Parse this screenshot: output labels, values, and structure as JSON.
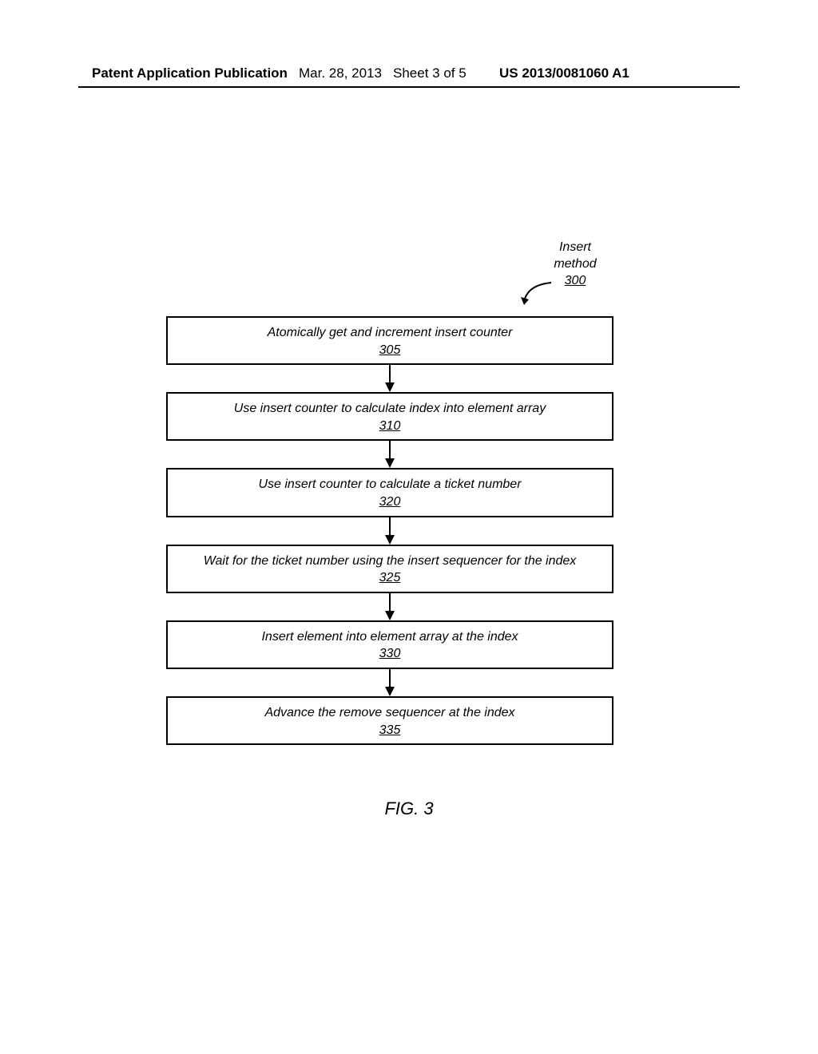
{
  "header": {
    "publication": "Patent Application Publication",
    "date": "Mar. 28, 2013",
    "sheet": "Sheet 3 of 5",
    "pubnum": "US 2013/0081060 A1"
  },
  "method_label": {
    "line1": "Insert",
    "line2": "method",
    "ref": "300"
  },
  "steps": [
    {
      "text": "Atomically get and increment insert counter",
      "ref": "305"
    },
    {
      "text": "Use insert counter to calculate index into element array",
      "ref": "310"
    },
    {
      "text": "Use insert counter to calculate a ticket number",
      "ref": "320"
    },
    {
      "text": "Wait for the ticket number using the insert sequencer for the index",
      "ref": "325"
    },
    {
      "text": "Insert element into element array at the index",
      "ref": "330"
    },
    {
      "text": "Advance the remove sequencer at the index",
      "ref": "335"
    }
  ],
  "figure_caption": "FIG. 3"
}
